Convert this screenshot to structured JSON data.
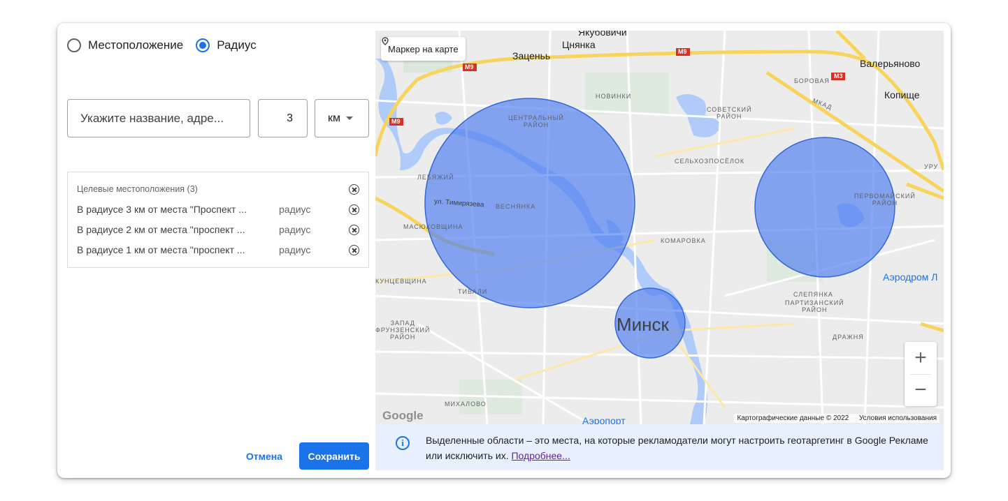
{
  "radio": {
    "location_label": "Местоположение",
    "radius_label": "Радиус",
    "selected": "radius"
  },
  "search": {
    "placeholder": "Укажите название, адре..."
  },
  "radius_value": "3",
  "unit": {
    "selected": "км"
  },
  "targets": {
    "header": "Целевые местоположения (3)",
    "items": [
      {
        "text": "В радиусе 3 км от места \"Проспект ...",
        "type": "радиус"
      },
      {
        "text": "В радиусе 2 км от места \"проспект ...",
        "type": "радиус"
      },
      {
        "text": "В радиусе 1 км от места \"проспект ...",
        "type": "радиус"
      }
    ]
  },
  "buttons": {
    "cancel": "Отмена",
    "save": "Сохранить"
  },
  "map": {
    "marker_button": "Маркер на карте",
    "zoom_in": "+",
    "zoom_out": "−",
    "google": "Google",
    "attribution": "Картографические данные © 2022",
    "terms": "Условия использования",
    "labels": {
      "yakubovichi": "Якубовичи",
      "tsnyanka": "Цнянка",
      "zatsen": "Заценьь",
      "valeryanovo": "Валерьяново",
      "kopishche": "Копище",
      "borovaya": "БОРОВАЯ",
      "novinki": "НОВИНКИ",
      "sovetsky": "СОВЕТСКИЙ\nРАЙОН",
      "central": "ЦЕНТРАЛЬНЫЙ\nРАЙОН",
      "mkad": "МКАД",
      "selkhoz": "СЕЛЬХОЗПОСЁЛОК",
      "lebyazhy": "ЛЕБЯЖИЙ",
      "timiryazeva": "ул. Тимирязева",
      "vesnyanka": "ВЕСНЯНКА",
      "masyukovshchina": "МАСЮКОВЩИНА",
      "komarovka": "КОМАРОВКА",
      "pervomaysky": "ПЕРВОМАЙСКИЙ\nРАЙОН",
      "kuntsevshchina": "КУНЦЕВЩИНА",
      "tivali": "ТИВАЛИ",
      "airport_l": "Аэродром Л",
      "slepyanka": "СЛЕПЯНКА",
      "partizansky": "ПАРТИЗАНСКИЙ\nРАЙОН",
      "frunzensky": "ЗАПАД\nФРУНЗЕНСКИЙ\nРАЙОН",
      "minsk": "Минск",
      "drazhnya": "ДРАЖНЯ",
      "mikhalovo": "МИХАЛОВО",
      "airport": "Аэропорт",
      "uru": "УРУ",
      "m9a": "M9",
      "m9b": "M9",
      "m9c": "M9",
      "m3": "M3"
    }
  },
  "info": {
    "text": "Выделенные области – это места, на которые рекламодатели могут настроить геотаргетинг в Google Рекламе или исключить их.",
    "link": "Подробнее..."
  },
  "colors": {
    "accent": "#1a73e8",
    "radius_fill": "#4f7ff0",
    "info_bg": "#e8f0fe",
    "link": "#681da8"
  }
}
